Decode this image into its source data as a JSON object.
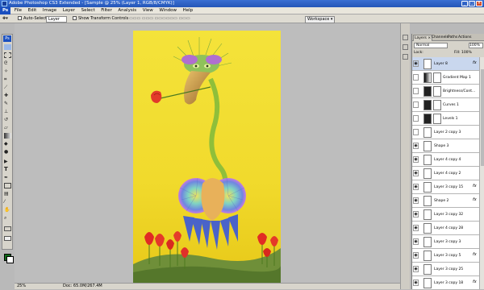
{
  "window": {
    "title": "Adobe Photoshop CS3 Extended - [Sample @ 25% (Layer 1, RGB/8/CMYK)]",
    "app_badge": "Ps"
  },
  "menu": {
    "items": [
      "File",
      "Edit",
      "Image",
      "Layer",
      "Select",
      "Filter",
      "Analysis",
      "View",
      "Window",
      "Help"
    ]
  },
  "options": {
    "auto_select_label": "Auto-Select:",
    "auto_select_value": "Layer",
    "transform_label": "Show Transform Controls",
    "workspace_label": "Workspace ▾"
  },
  "status": {
    "zoom": "25%",
    "doc": "Doc: 65.0M/267.4M"
  },
  "panel": {
    "tabs": [
      "Layers ×",
      "Channels",
      "Paths",
      "Actions"
    ],
    "blend_mode": "Normal",
    "opacity": "100%",
    "lock_label": "Lock:",
    "fill_label": "Fill: 100%",
    "layers": [
      {
        "name": "Layer 8",
        "eye": true,
        "fx": true,
        "sel": true
      },
      {
        "name": "Gradient Map 1",
        "eye": false,
        "fx": false
      },
      {
        "name": "Brightness/Cont...",
        "eye": false,
        "fx": false
      },
      {
        "name": "Curves 1",
        "eye": false,
        "fx": false
      },
      {
        "name": "Levels 1",
        "eye": false,
        "fx": false
      },
      {
        "name": "Layer 2 copy 3",
        "eye": false,
        "fx": false
      },
      {
        "name": "Shape 3",
        "eye": true,
        "fx": false
      },
      {
        "name": "Layer 4 copy 4",
        "eye": true,
        "fx": false
      },
      {
        "name": "Layer 4 copy 2",
        "eye": true,
        "fx": false
      },
      {
        "name": "Layer 3 copy 15",
        "eye": true,
        "fx": true
      },
      {
        "name": "Shape 2",
        "eye": true,
        "fx": true
      },
      {
        "name": "Layer 3 copy 32",
        "eye": true,
        "fx": false
      },
      {
        "name": "Layer 4 copy 28",
        "eye": true,
        "fx": false
      },
      {
        "name": "Layer 3 copy 3",
        "eye": true,
        "fx": false
      },
      {
        "name": "Layer 3 copy 5",
        "eye": true,
        "fx": true
      },
      {
        "name": "Layer 3 copy 25",
        "eye": true,
        "fx": false
      },
      {
        "name": "Layer 3 copy 18",
        "eye": true,
        "fx": true
      }
    ]
  },
  "colors": {
    "foreground": "#0e6a1a",
    "background": "#ffffff",
    "canvas_bg": "#f2dc2e"
  }
}
